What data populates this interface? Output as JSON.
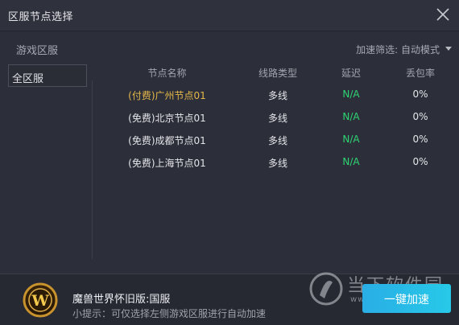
{
  "window": {
    "title": "区服节点选择"
  },
  "sidebar": {
    "title": "游戏区服",
    "items": [
      {
        "label": "全区服"
      }
    ]
  },
  "filter": {
    "label": "加速筛选: 自动模式"
  },
  "table": {
    "headers": [
      "节点名称",
      "线路类型",
      "延迟",
      "丢包率"
    ],
    "rows": [
      {
        "name": "(付费)广州节点01",
        "type": "多线",
        "latency": "N/A",
        "loss": "0%",
        "paid": true
      },
      {
        "name": "(免费)北京节点01",
        "type": "多线",
        "latency": "N/A",
        "loss": "0%",
        "paid": false
      },
      {
        "name": "(免费)成都节点01",
        "type": "多线",
        "latency": "N/A",
        "loss": "0%",
        "paid": false
      },
      {
        "name": "(免费)上海节点01",
        "type": "多线",
        "latency": "N/A",
        "loss": "0%",
        "paid": false
      }
    ]
  },
  "footer": {
    "game_name": "魔兽世界怀旧版:国服",
    "tip": "小提示：可仅选择左侧游戏区服进行自动加速",
    "accelerate_label": "一键加速",
    "logo_letter": "W"
  },
  "watermark": {
    "text": "当下软件园",
    "url": "www.downxia.com"
  },
  "colors": {
    "background": "#2c2e39",
    "paid": "#e5b94a",
    "latency": "#2ed573",
    "accent": "#29aee6"
  },
  "icons": {
    "close": "close-icon",
    "dropdown": "caret-down-icon",
    "game": "wow-logo-icon"
  }
}
